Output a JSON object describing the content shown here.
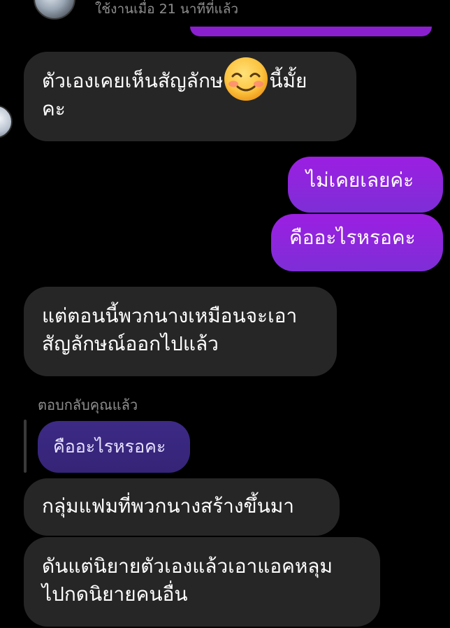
{
  "header": {
    "active_status": "ใช้งานเมื่อ 21 นาทีที่แล้ว"
  },
  "messages": {
    "m1_text_a": "ตัวเองเคยเห็นสัญลักษ",
    "m1_text_b": "นี้มั้ย",
    "m1_text_c": "คะ",
    "m1_emoji": "smiling-face-emoji",
    "m2_text": "ไม่เคยเลยค่ะ",
    "m3_text": "คืออะไรหรอคะ",
    "m4_line1": "แต่ตอนนี้พวกนางเหมือนจะเอา",
    "m4_line2": "สัญลักษณ์ออกไปแล้ว",
    "reply_label": "ตอบกลับคุณแล้ว",
    "reply_quote": "คืออะไรหรอคะ",
    "m5_text": "กลุ่มแฟมที่พวกนางสร้างขึ้นมา",
    "m6_line1": "ดันแต่นิยายตัวเองแล้วเอาแอคหลุม",
    "m6_line2": "ไปกดนิยายคนอื่น"
  },
  "colors": {
    "background": "#000000",
    "received_bubble": "#262626",
    "sent_bubble": "#8a1fd0",
    "reply_bubble": "#3c2a86",
    "muted_text": "#8e8e8e"
  }
}
